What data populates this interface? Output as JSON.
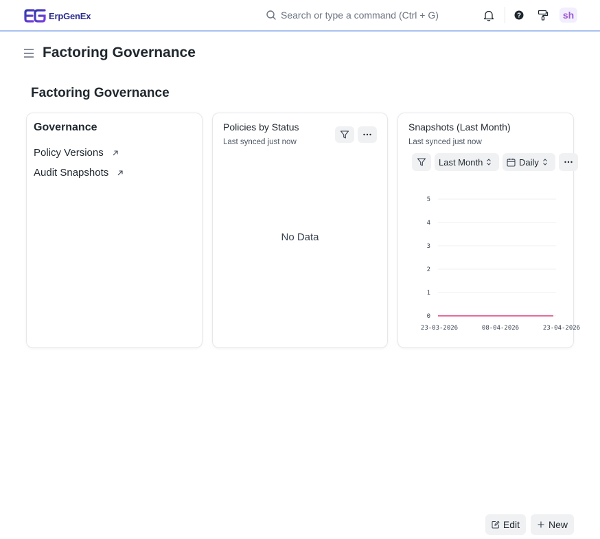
{
  "navbar": {
    "brand": "ErpGenEx",
    "search_placeholder": "Search or type a command (Ctrl + G)",
    "avatar_initials": "sh",
    "icons": [
      "bell-icon",
      "help-icon",
      "paint-roller-icon"
    ]
  },
  "page": {
    "title": "Factoring Governance",
    "section_title": "Factoring Governance"
  },
  "governance_card": {
    "title": "Governance",
    "links": [
      {
        "label": "Policy Versions"
      },
      {
        "label": "Audit Snapshots"
      }
    ]
  },
  "policies_card": {
    "title": "Policies by Status",
    "subtitle": "Last synced just now",
    "empty_text": "No Data"
  },
  "snapshots_card": {
    "title": "Snapshots (Last Month)",
    "subtitle": "Last synced just now",
    "range_select": "Last Month",
    "interval_select": "Daily"
  },
  "chart_data": {
    "type": "line",
    "x": [
      "23-03-2026",
      "08-04-2026",
      "23-04-2026"
    ],
    "series": [
      {
        "values": [
          0,
          0,
          0
        ],
        "color": "#e56b9b"
      }
    ],
    "ylim": [
      0,
      5
    ],
    "yticks": [
      "0",
      "1",
      "2",
      "3",
      "4",
      "5"
    ],
    "grid": true
  },
  "actions": {
    "edit_label": "Edit",
    "new_label": "New"
  }
}
